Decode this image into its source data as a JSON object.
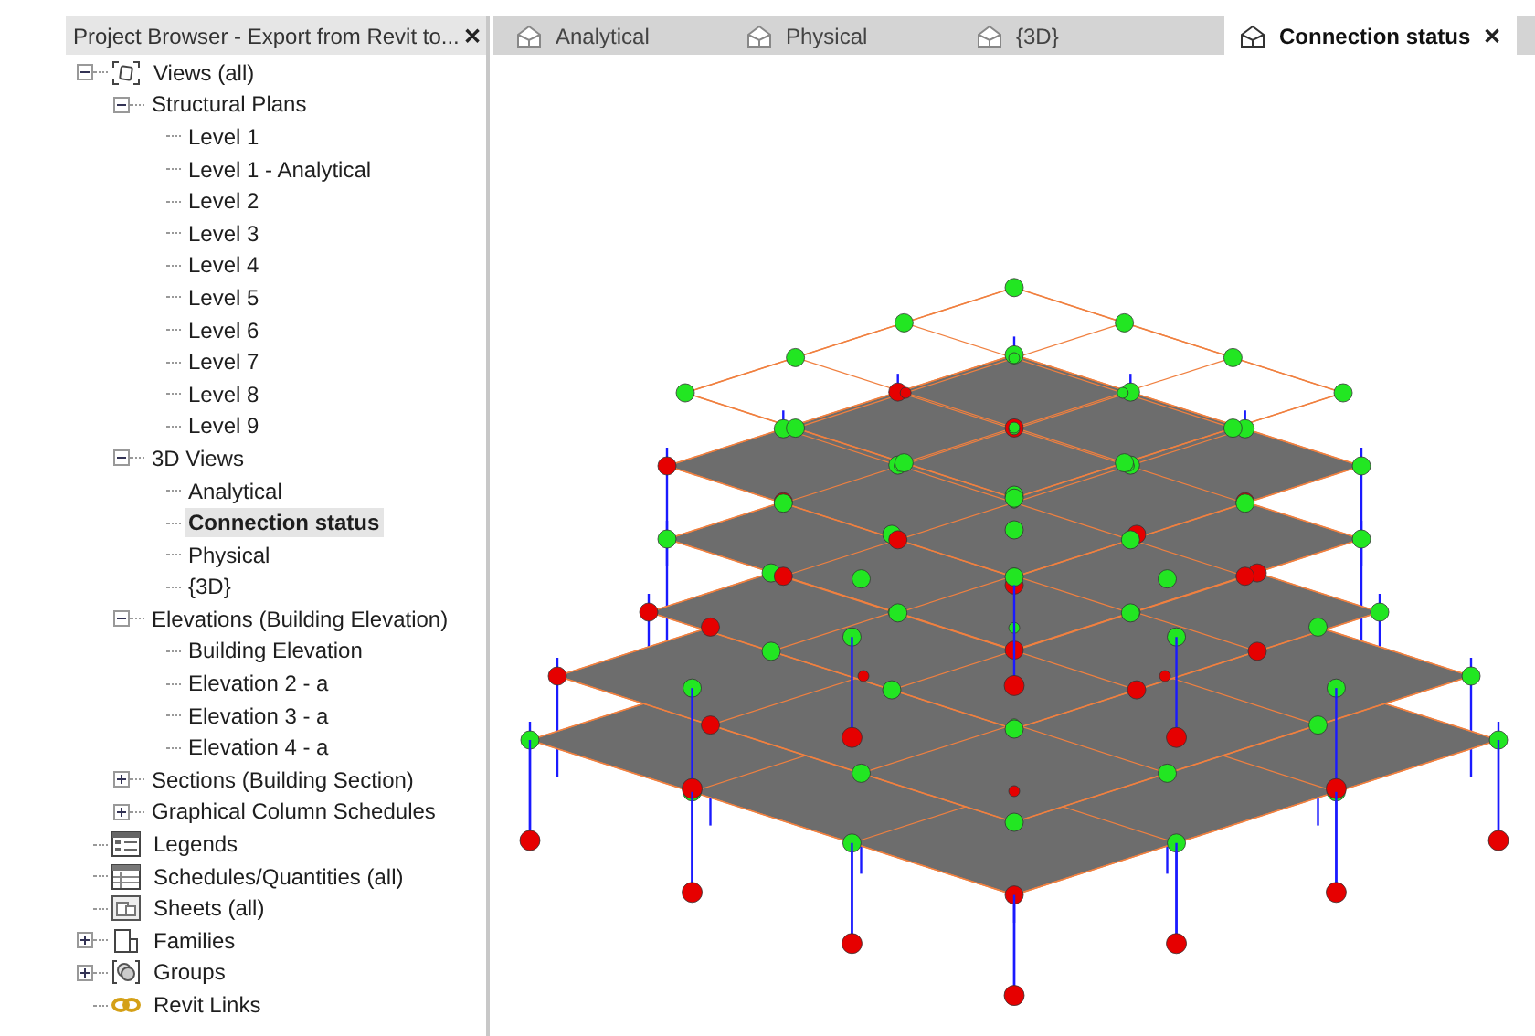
{
  "project_browser": {
    "title": "Project Browser - Export from Revit to...",
    "close": "✕",
    "tree": [
      {
        "label": "Views (all)",
        "kind": "views",
        "expanded": true,
        "selected": false,
        "children": [
          {
            "label": "Structural Plans",
            "expanded": true,
            "selected": false,
            "children": [
              {
                "label": "Level 1",
                "selected": false
              },
              {
                "label": "Level 1 - Analytical",
                "selected": false
              },
              {
                "label": "Level 2",
                "selected": false
              },
              {
                "label": "Level 3",
                "selected": false
              },
              {
                "label": "Level 4",
                "selected": false
              },
              {
                "label": "Level 5",
                "selected": false
              },
              {
                "label": "Level 6",
                "selected": false
              },
              {
                "label": "Level 7",
                "selected": false
              },
              {
                "label": "Level 8",
                "selected": false
              },
              {
                "label": "Level 9",
                "selected": false
              }
            ]
          },
          {
            "label": "3D Views",
            "expanded": true,
            "selected": false,
            "children": [
              {
                "label": "Analytical",
                "selected": false
              },
              {
                "label": "Connection status",
                "selected": true
              },
              {
                "label": "Physical",
                "selected": false
              },
              {
                "label": "{3D}",
                "selected": false
              }
            ]
          },
          {
            "label": "Elevations (Building Elevation)",
            "expanded": true,
            "selected": false,
            "children": [
              {
                "label": "Building Elevation",
                "selected": false
              },
              {
                "label": "Elevation 2 - a",
                "selected": false
              },
              {
                "label": "Elevation 3 - a",
                "selected": false
              },
              {
                "label": "Elevation 4 - a",
                "selected": false
              }
            ]
          },
          {
            "label": "Sections (Building Section)",
            "expanded": false,
            "selected": false
          },
          {
            "label": "Graphical Column Schedules",
            "expanded": false,
            "selected": false
          }
        ]
      },
      {
        "label": "Legends",
        "kind": "legends",
        "selected": false
      },
      {
        "label": "Schedules/Quantities (all)",
        "kind": "schedules",
        "selected": false
      },
      {
        "label": "Sheets (all)",
        "kind": "sheets",
        "selected": false
      },
      {
        "label": "Families",
        "kind": "families",
        "expanded": false,
        "selected": false
      },
      {
        "label": "Groups",
        "kind": "groups",
        "expanded": false,
        "selected": false
      },
      {
        "label": "Revit Links",
        "kind": "links",
        "selected": false
      }
    ]
  },
  "view_tabs": [
    {
      "label": "Analytical",
      "selected": false
    },
    {
      "label": "Physical",
      "selected": false
    },
    {
      "label": "{3D}",
      "selected": false
    },
    {
      "label": "Connection status",
      "selected": true,
      "close": "✕"
    }
  ]
}
